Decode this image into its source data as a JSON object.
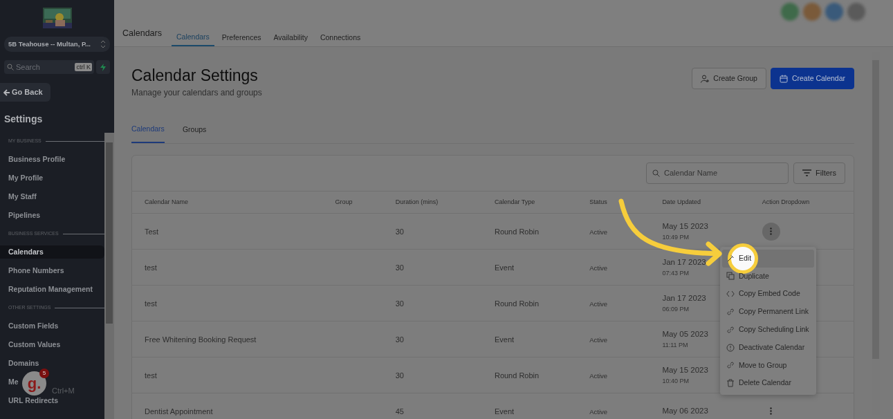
{
  "sidebar": {
    "account": "5B Teahouse -- Multan, P...",
    "search_placeholder": "Search",
    "search_shortcut": "ctrl K",
    "back": "Go Back",
    "heading": "Settings",
    "sections": [
      {
        "title": "MY BUSINESS",
        "items": [
          {
            "label": "Business Profile",
            "selected": false
          },
          {
            "label": "My Profile",
            "selected": false
          },
          {
            "label": "My Staff",
            "selected": false
          },
          {
            "label": "Pipelines",
            "selected": false
          }
        ]
      },
      {
        "title": "BUSINESS SERVICES",
        "items": [
          {
            "label": "Calendars",
            "selected": true
          },
          {
            "label": "Phone Numbers",
            "selected": false
          },
          {
            "label": "Reputation Management",
            "selected": false
          }
        ]
      },
      {
        "title": "OTHER SETTINGS",
        "items": [
          {
            "label": "Custom Fields",
            "selected": false
          },
          {
            "label": "Custom Values",
            "selected": false
          },
          {
            "label": "Domains",
            "selected": false
          },
          {
            "label": "Me",
            "selected": false
          },
          {
            "label": "URL Redirects",
            "selected": false
          }
        ]
      }
    ]
  },
  "chat_widget": {
    "logo": "g.",
    "badge": "5",
    "hint": "Ctrl+M"
  },
  "header": {
    "title": "Calendars",
    "tabs": [
      {
        "label": "Calendars",
        "selected": true
      },
      {
        "label": "Preferences",
        "selected": false
      },
      {
        "label": "Availability",
        "selected": false
      },
      {
        "label": "Connections",
        "selected": false
      }
    ]
  },
  "page": {
    "title": "Calendar Settings",
    "subtitle": "Manage your calendars and groups",
    "buttons": [
      {
        "label": "Create Group",
        "kind": "outline"
      },
      {
        "label": "Create Calendar",
        "kind": "primary"
      }
    ],
    "tabs": [
      {
        "label": "Calendars",
        "selected": true
      },
      {
        "label": "Groups",
        "selected": false
      }
    ]
  },
  "table": {
    "search_placeholder": "Calendar Name",
    "filters": "Filters",
    "columns": [
      "Calendar Name",
      "Group",
      "Duration (mins)",
      "Calendar Type",
      "Status",
      "Date Updated",
      "Action Dropdown"
    ],
    "rows": [
      {
        "name": "Test",
        "duration": "30",
        "type": "Round Robin",
        "status": "Active",
        "date": "May 15 2023",
        "time": "10:49 PM",
        "menu_open": true
      },
      {
        "name": "test",
        "duration": "30",
        "type": "Event",
        "status": "Active",
        "date": "Jan 17 2023",
        "time": "07:43 PM",
        "menu_open": false
      },
      {
        "name": "test",
        "duration": "30",
        "type": "Round Robin",
        "status": "Active",
        "date": "Jan 17 2023",
        "time": "06:09 PM",
        "menu_open": false
      },
      {
        "name": "Free Whitening Booking Request",
        "duration": "30",
        "type": "Event",
        "status": "Active",
        "date": "May 05 2023",
        "time": "11:11 PM",
        "menu_open": false
      },
      {
        "name": "test",
        "duration": "30",
        "type": "Round Robin",
        "status": "Active",
        "date": "May 15 2023",
        "time": "10:40 PM",
        "menu_open": false
      },
      {
        "name": "Dentist Appointment",
        "duration": "45",
        "type": "Event",
        "status": "Active",
        "date": "May 06 2023",
        "menu_open": false
      }
    ]
  },
  "menu": [
    {
      "label": "Edit",
      "kind": "edit",
      "selected": true
    },
    {
      "label": "Duplicate",
      "kind": "copy",
      "selected": false
    },
    {
      "label": "Copy Embed Code",
      "kind": "code",
      "selected": false
    },
    {
      "label": "Copy Permanent Link",
      "kind": "link",
      "selected": false
    },
    {
      "label": "Copy Scheduling Link",
      "kind": "link",
      "selected": false
    },
    {
      "label": "Deactivate Calendar",
      "kind": "alert",
      "selected": false
    },
    {
      "label": "Move to Group",
      "kind": "link",
      "selected": false
    },
    {
      "label": "Delete Calendar",
      "kind": "trash",
      "selected": false
    }
  ]
}
